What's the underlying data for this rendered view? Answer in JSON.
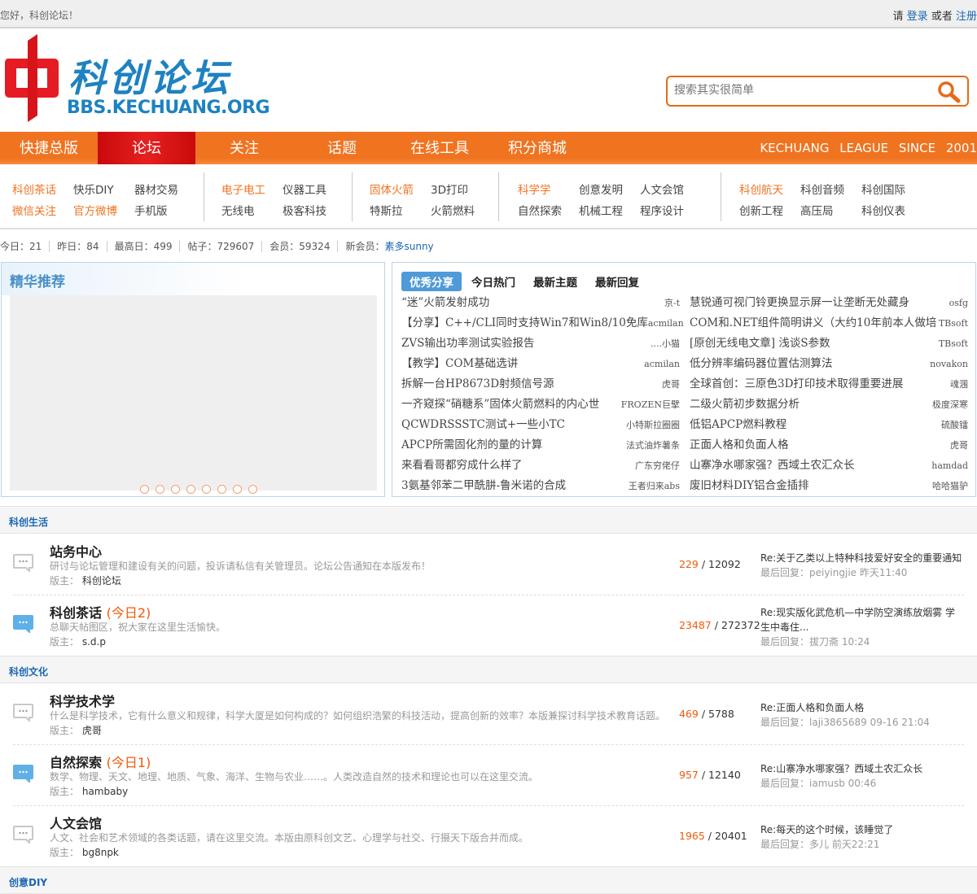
{
  "topbar": {
    "greeting": "您好，科创论坛！",
    "please": "请",
    "login": "登录",
    "or": "或者",
    "register": "注册"
  },
  "logo": {
    "cn": "科创论坛",
    "en": "BBS.KECHUANG.ORG"
  },
  "search": {
    "placeholder": "搜索其实很简单"
  },
  "nav": {
    "items": [
      "快捷总版",
      "论坛",
      "关注",
      "话题",
      "在线工具",
      "积分商城"
    ],
    "tagline": "KECHUANG LEAGUE  SINCE 2001"
  },
  "quick": [
    [
      "科创茶话",
      "快乐DIY",
      "器材交易",
      "微信关注",
      "官方微博",
      "手机版"
    ],
    [
      "电子电工",
      "仪器工具",
      "无线电",
      "极客科技"
    ],
    [
      "固体火箭",
      "3D打印",
      "特斯拉",
      "火箭燃料"
    ],
    [
      "科学学",
      "创意发明",
      "人文会馆",
      "自然探索",
      "机械工程",
      "程序设计"
    ],
    [
      "科创航天",
      "科创音频",
      "科创国际",
      "创新工程",
      "高压局",
      "科创仪表"
    ]
  ],
  "stats": {
    "today": "今日：21",
    "yesterday": "昨日：84",
    "max": "最高日：499",
    "posts": "帖子：729607",
    "members": "会员：59324",
    "newmember_label": "新会员：",
    "newmember": "素多sunny"
  },
  "featured": {
    "title": "精华推荐",
    "slide_count": 8
  },
  "hot": {
    "tabs": [
      "优秀分享",
      "今日热门",
      "最新主题",
      "最新回复"
    ],
    "left": [
      {
        "title": "“迷”火箭发射成功",
        "author": "京-t"
      },
      {
        "title": "【分享】C++/CLI同时支持Win7和Win8/10免库",
        "author": "acmilan"
      },
      {
        "title": "ZVS输出功率测试实验报告",
        "author": "....小猫"
      },
      {
        "title": "【教学】COM基础选讲",
        "author": "acmilan"
      },
      {
        "title": "拆解一台HP8673D射频信号源",
        "author": "虎哥"
      },
      {
        "title": "一齐窥探“硝糖系”固体火箭燃料的内心世",
        "author": "FROZEN巨擘"
      },
      {
        "title": "QCWDRSSSTC测试+一些小TC",
        "author": "小特斯拉圈圈"
      },
      {
        "title": "APCP所需固化剂的量的计算",
        "author": "法式油炸薯条"
      },
      {
        "title": "来看看哥都穷成什么样了",
        "author": "广东穷佬仔"
      },
      {
        "title": "3氨基邻苯二甲酰肼-鲁米诺的合成",
        "author": "王者归来abs"
      }
    ],
    "right": [
      {
        "title": "慧锐通可视门铃更换显示屏一让垄断无处藏身",
        "author": "osfg"
      },
      {
        "title": "COM和.NET组件简明讲义（大约10年前本人做培",
        "author": "TBsoft"
      },
      {
        "title": "[原创无线电文章] 浅谈S参数",
        "author": "TBsoft"
      },
      {
        "title": "低分辨率编码器位置估测算法",
        "author": "novakon"
      },
      {
        "title": "全球首创：三原色3D打印技术取得重要进展",
        "author": "魂涠"
      },
      {
        "title": "二级火箭初步数据分析",
        "author": "极度深寒"
      },
      {
        "title": "低铝APCP燃料教程",
        "author": "硫酸镭"
      },
      {
        "title": "正面人格和负面人格",
        "author": "虎哥"
      },
      {
        "title": "山寨净水哪家强？西域土农汇众长",
        "author": "hamdad"
      },
      {
        "title": "废旧材料DIY铝合金插排",
        "author": "哈哈猫驴"
      }
    ]
  },
  "sections": [
    {
      "name": "科创生活",
      "forums": [
        {
          "name": "站务中心",
          "today": "",
          "desc": "研讨与论坛管理和建设有关的问题，投诉请私信有关管理员。论坛公告通知在本版发布！",
          "mod_label": "版主：",
          "mod": "科创论坛",
          "threads": "229",
          "posts": "12092",
          "last": "Re:关于乙类以上特种科技爱好安全的重要通知",
          "last_by": "最后回复：peiyingjie 昨天11:40",
          "new": false
        },
        {
          "name": "科创茶话",
          "today": "(今日2)",
          "desc": "总聊天帖图区，祝大家在这里生活愉快。",
          "mod_label": "版主：",
          "mod": "s.d.p",
          "threads": "23487",
          "posts": "272372",
          "last": "Re:现实版化武危机—中学防空演练放烟雾 学生中毒住...",
          "last_by": "最后回复：拔刀斋 10:24",
          "new": true
        }
      ]
    },
    {
      "name": "科创文化",
      "forums": [
        {
          "name": "科学技术学",
          "today": "",
          "desc": "什么是科学技术，它有什么意义和规律，科学大厦是如何构成的？如何组织浩繁的科技活动，提高创新的效率？本版兼探讨科学技术教育话题。",
          "mod_label": "版主：",
          "mod": "虎哥",
          "threads": "469",
          "posts": "5788",
          "last": "Re:正面人格和负面人格",
          "last_by": "最后回复：laji3865689 09-16 21:04",
          "new": false
        },
        {
          "name": "自然探索",
          "today": "(今日1)",
          "desc": "数学、物理、天文、地理、地质、气象、海洋、生物与农业……。人类改造自然的技术和理论也可以在这里交流。",
          "mod_label": "版主：",
          "mod": "hambaby",
          "threads": "957",
          "posts": "12140",
          "last": "Re:山寨净水哪家强？西域土农汇众长",
          "last_by": "最后回复：iamusb 00:46",
          "new": true
        },
        {
          "name": "人文会馆",
          "today": "",
          "desc": "人文、社会和艺术领域的各类话题，请在这里交流。本版由原科创文艺、心理学与社交、行摄天下版合并而成。",
          "mod_label": "版主：",
          "mod": "bg8npk",
          "threads": "1965",
          "posts": "20401",
          "last": "Re:每天的这个时候，该睡觉了",
          "last_by": "最后回复：多儿 前天22:21",
          "new": false
        }
      ]
    },
    {
      "name": "创意DIY"
    }
  ],
  "colors": {
    "orange": "#f07320",
    "red": "#e01818",
    "blue": "#1a66b3",
    "icon_new": "#5fb0e8",
    "icon_old": "#c8c8c8"
  }
}
